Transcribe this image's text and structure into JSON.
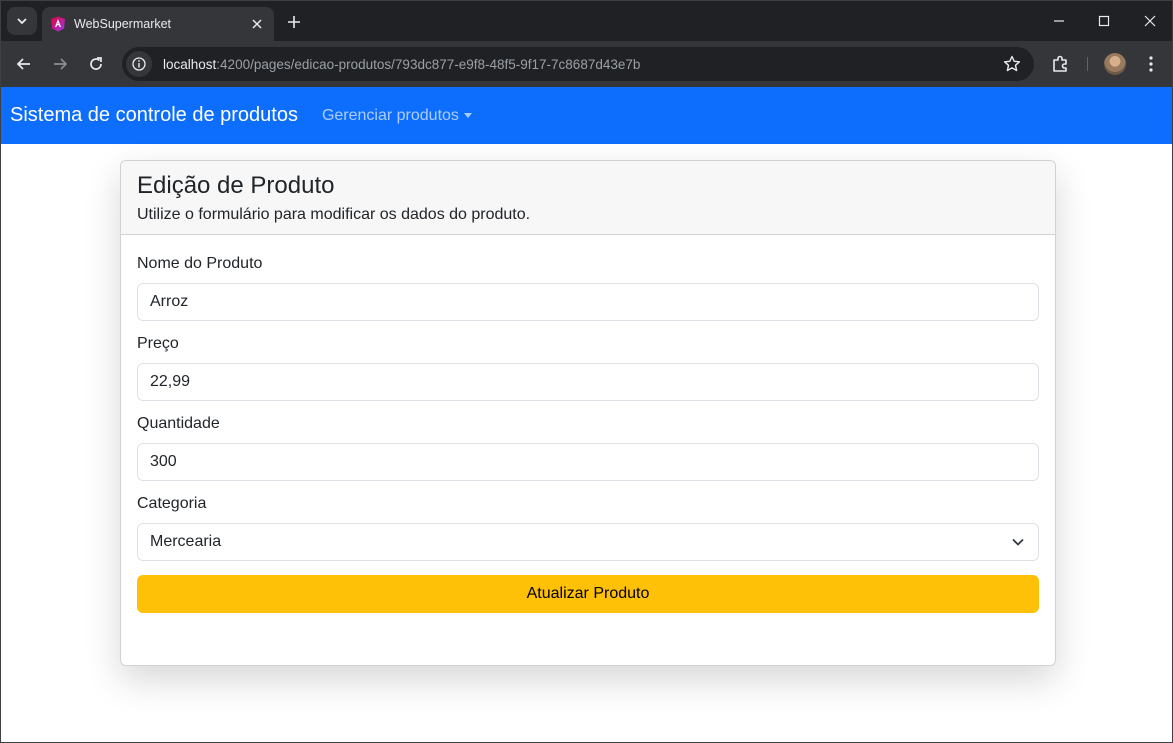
{
  "browser": {
    "tab_title": "WebSupermarket",
    "url_host": "localhost",
    "url_rest": ":4200/pages/edicao-produtos/793dc877-e9f8-48f5-9f17-7c8687d43e7b"
  },
  "navbar": {
    "brand": "Sistema de controle de produtos",
    "dropdown_label": "Gerenciar produtos"
  },
  "card": {
    "title": "Edição de Produto",
    "subtitle": "Utilize o formulário para modificar os dados do produto."
  },
  "form": {
    "nome_label": "Nome do Produto",
    "nome_value": "Arroz",
    "preco_label": "Preço",
    "preco_value": "22,99",
    "quantidade_label": "Quantidade",
    "quantidade_value": "300",
    "categoria_label": "Categoria",
    "categoria_value": "Mercearia",
    "submit_label": "Atualizar Produto"
  },
  "colors": {
    "navbar": "#0d6efd",
    "submit_button": "#ffc107"
  },
  "icons": {
    "tab_favicon": "angular-logo-icon",
    "site_info": "info-icon",
    "bookmark": "star-icon",
    "extensions": "puzzle-icon",
    "select": "chevron-down-icon"
  }
}
